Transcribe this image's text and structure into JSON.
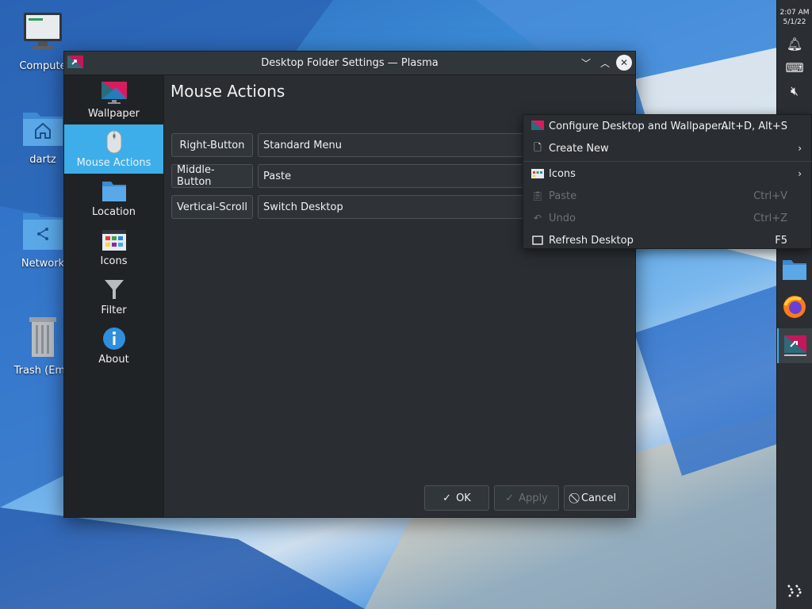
{
  "desktop": {
    "icons": [
      {
        "label": "Compute",
        "icon": "computer-icon"
      },
      {
        "label": "dartz",
        "icon": "home-folder-icon"
      },
      {
        "label": "Network",
        "icon": "network-folder-icon"
      },
      {
        "label": "Trash (Emp",
        "icon": "trash-icon"
      }
    ]
  },
  "panel": {
    "time": "2:07 AM",
    "date": "5/1/22",
    "icons": [
      "notifications-icon",
      "keyboard-icon",
      "volume-muted-icon",
      "files-icon",
      "firefox-icon",
      "kde-settings-icon",
      "kde-connect-icon"
    ]
  },
  "window": {
    "title": "Desktop Folder Settings — Plasma",
    "sidebar": [
      {
        "label": "Wallpaper",
        "icon": "wallpaper-icon",
        "active": false
      },
      {
        "label": "Mouse Actions",
        "icon": "mouse-icon",
        "active": true
      },
      {
        "label": "Location",
        "icon": "folder-icon",
        "active": false
      },
      {
        "label": "Icons",
        "icon": "icons-icon",
        "active": false
      },
      {
        "label": "Filter",
        "icon": "filter-icon",
        "active": false
      },
      {
        "label": "About",
        "icon": "info-icon",
        "active": false
      }
    ],
    "page_title": "Mouse Actions",
    "actions": [
      {
        "button": "Right-Button",
        "value": "Standard Menu"
      },
      {
        "button": "Middle-Button",
        "value": "Paste"
      },
      {
        "button": "Vertical-Scroll",
        "value": "Switch Desktop"
      }
    ],
    "footer": {
      "ok": "OK",
      "apply": "Apply",
      "cancel": "Cancel"
    }
  },
  "context_menu": {
    "items": [
      {
        "label": "Configure Desktop and Wallpaper...",
        "shortcut": "Alt+D, Alt+S",
        "icon": "configure-icon",
        "enabled": true,
        "submenu": false
      },
      {
        "label": "Create New",
        "shortcut": "",
        "icon": "new-file-icon",
        "enabled": true,
        "submenu": true
      },
      {
        "label": "Icons",
        "shortcut": "",
        "icon": "icons-icon",
        "enabled": true,
        "submenu": true
      },
      {
        "label": "Paste",
        "shortcut": "Ctrl+V",
        "icon": "paste-icon",
        "enabled": false,
        "submenu": false
      },
      {
        "label": "Undo",
        "shortcut": "Ctrl+Z",
        "icon": "undo-icon",
        "enabled": false,
        "submenu": false
      },
      {
        "label": "Refresh Desktop",
        "shortcut": "F5",
        "icon": "refresh-icon",
        "enabled": true,
        "submenu": false
      }
    ]
  },
  "colors": {
    "accent": "#3daee9",
    "window_bg": "#2a2e32",
    "sidebar_bg": "#202326",
    "titlebar_bg": "#31363b"
  }
}
